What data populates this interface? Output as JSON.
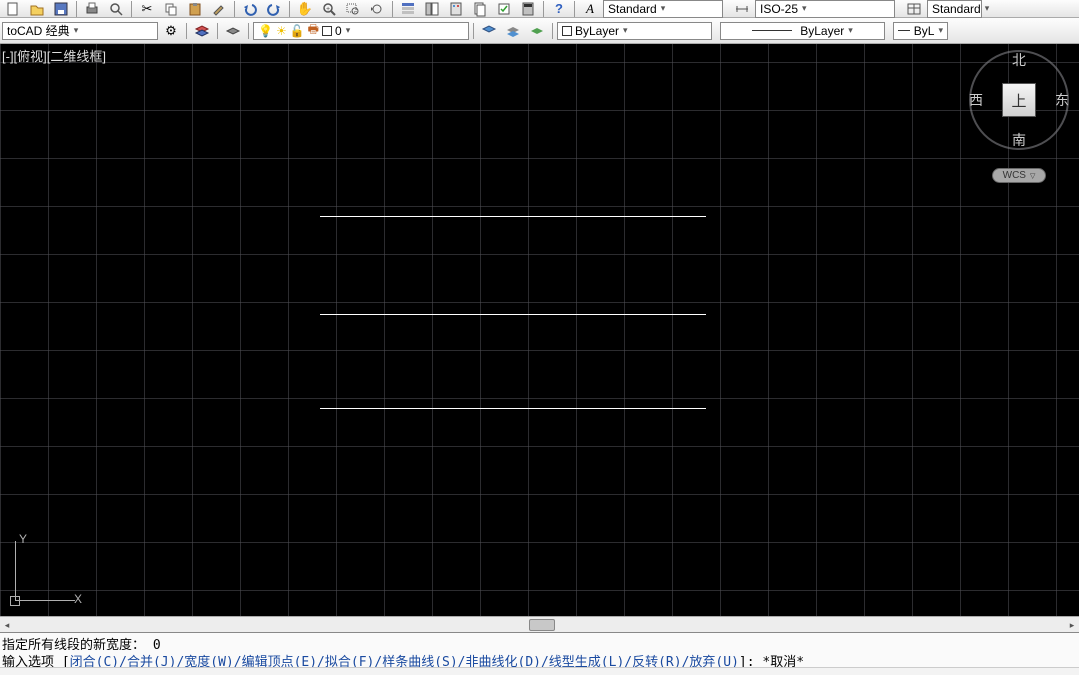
{
  "toolbar_top": {
    "textstyle": {
      "label": "Standard"
    },
    "dimstyle": {
      "label": "ISO-25"
    },
    "tablestyle": {
      "label": "Standard"
    }
  },
  "toolbar_second": {
    "workspace": "toCAD 经典",
    "layer0": "0",
    "bylayer_color": "ByLayer",
    "bylayer_linetype": "ByLayer",
    "byl_right": "ByL"
  },
  "viewport": {
    "label": "[-][俯视][二维线框]"
  },
  "ucs": {
    "x": "X",
    "y": "Y"
  },
  "viewcube": {
    "face": "上",
    "north": "北",
    "south": "南",
    "west": "西",
    "east": "东",
    "wcs": "WCS"
  },
  "command": {
    "line1_prefix": "指定所有线段的新宽度：",
    "line1_value": "0",
    "line2_prefix": "输入选项 [",
    "line2_options": "闭合(C)/合并(J)/宽度(W)/编辑顶点(E)/拟合(F)/样条曲线(S)/非曲线化(D)/线型生成(L)/反转(R)/放弃(U)",
    "line2_suffix": "]: *取消*"
  }
}
